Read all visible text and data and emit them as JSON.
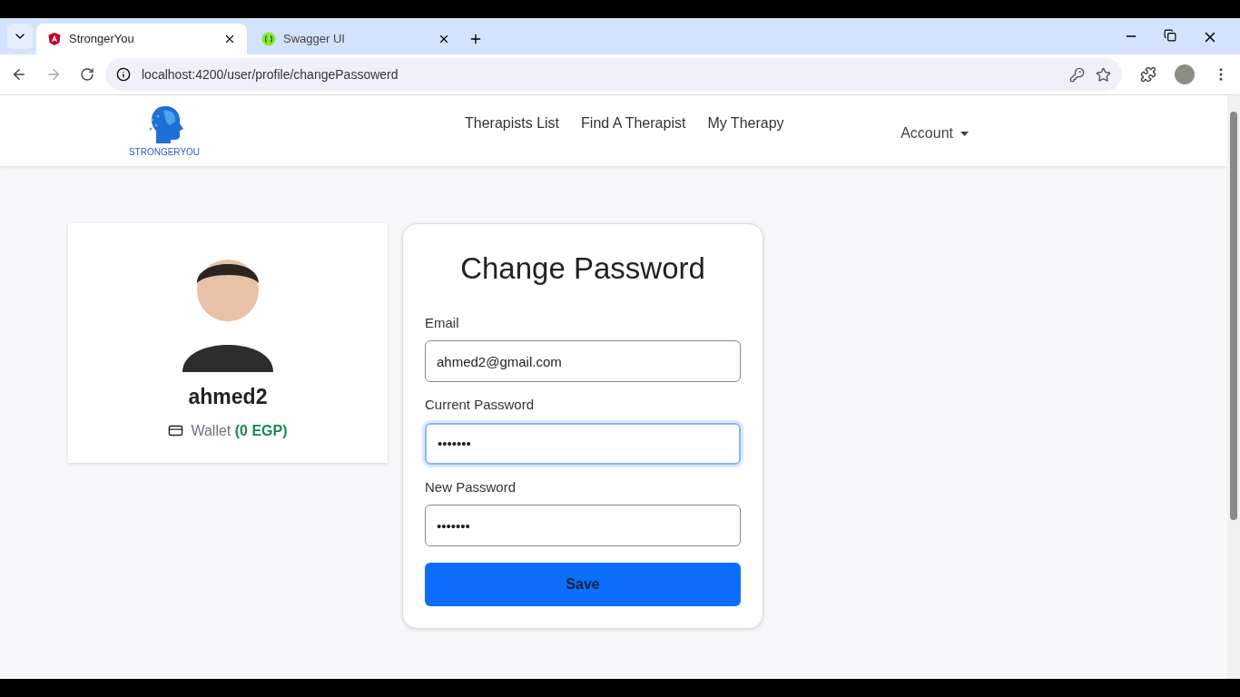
{
  "browser": {
    "tabs": [
      {
        "title": "StrongerYou",
        "selected": true,
        "kind": "app"
      },
      {
        "title": "Swagger UI",
        "selected": false,
        "kind": "swagger"
      }
    ],
    "url": "localhost:4200/user/profile/changePassowerd"
  },
  "navbar": {
    "logo_text": "STRONGERYOU",
    "links": [
      "Therapists List",
      "Find A Therapist",
      "My Therapy"
    ],
    "account": "Account"
  },
  "profile": {
    "name": "ahmed2",
    "wallet_label": "Wallet",
    "wallet_amount": "(0 EGP)"
  },
  "form": {
    "title": "Change Password",
    "fields": [
      {
        "label": "Email",
        "value": "ahmed2@gmail.com",
        "focused": false
      },
      {
        "label": "Current Password",
        "value": "•••••••",
        "focused": true
      },
      {
        "label": "New Password",
        "value": "•••••••",
        "focused": false
      }
    ],
    "button": "Save"
  }
}
